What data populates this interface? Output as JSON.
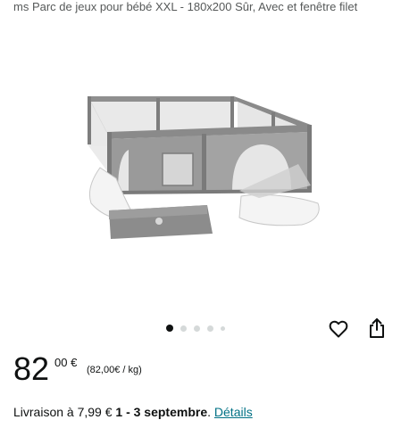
{
  "product": {
    "title": "ms Parc de jeux pour bébé XXL - 180x200 Sûr, Avec et fenêtre filet",
    "image_icon": "baby-playpen-image"
  },
  "carousel": {
    "total": 5,
    "active_index": 1
  },
  "actions": {
    "wishlist_icon": "heart-icon",
    "share_icon": "share-icon"
  },
  "price": {
    "whole": "82",
    "fraction": "00 €",
    "unit_price": "(82,00€ / kg)"
  },
  "delivery": {
    "prefix": "Livraison à 7,99 € ",
    "dates": "1 - 3 septembre",
    "separator": ". ",
    "details_link": "Détails"
  },
  "colors": {
    "link": "#007185",
    "text": "#0f1111",
    "muted": "#565959",
    "dot_inactive": "#d5d9d9"
  }
}
